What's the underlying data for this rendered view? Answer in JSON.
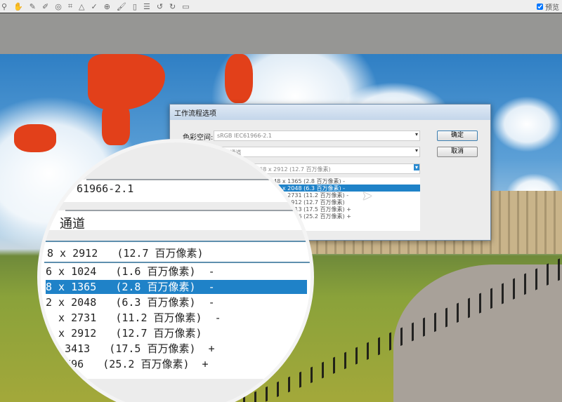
{
  "toolbar": {
    "icons": [
      "zoom-icon",
      "hand-icon",
      "eyedropper-icon",
      "color-sampler-icon",
      "target-adjust-icon",
      "crop-icon",
      "straighten-icon",
      "spot-removal-icon",
      "red-eye-icon",
      "brush-icon",
      "graduated-filter-icon",
      "list-icon",
      "rotate-left-icon",
      "rotate-right-icon",
      "trash-icon"
    ],
    "preview_label": "预览",
    "preview_checked": true
  },
  "dialog": {
    "title": "工作流程选项",
    "color_space_label": "色彩空间:",
    "color_space_value": "sRGB IEC61966-2.1",
    "depth_value": "8 位/通道",
    "size_value": "4368 x 2912 (12.7 百万像素)",
    "ok": "确定",
    "cancel": "取消",
    "size_options": [
      "2048 x 1365 (2.8 百万像素) -",
      "3072 x 2048 (6.3 百万像素) -",
      "4096 x 2731 (11.2 百万像素) -",
      "4368 x 2912 (12.7 百万像素)",
      "5120 x 3413 (17.5 百万像素) +",
      "6144 x 4096 (25.2 百万像素) +"
    ],
    "selected_index": 1
  },
  "magnifier": {
    "color_space": "61966-2.1",
    "depth": "通道",
    "current": "8 x 2912   (12.7 百万像素)",
    "rows": [
      "6 x 1024   (1.6 百万像素)  -",
      "8 x 1365   (2.8 百万像素)  -",
      "2 x 2048   (6.3 百万像素)  -",
      "  x 2731   (11.2 百万像素)  -",
      "  x 2912   (12.7 百万像素)",
      "   3413   (17.5 百万像素)  +",
      "   796   (25.2 百万像素)  +"
    ],
    "selected_index": 1
  },
  "colors": {
    "highlight": "#1f82c8",
    "clipping": "#e2401a"
  }
}
